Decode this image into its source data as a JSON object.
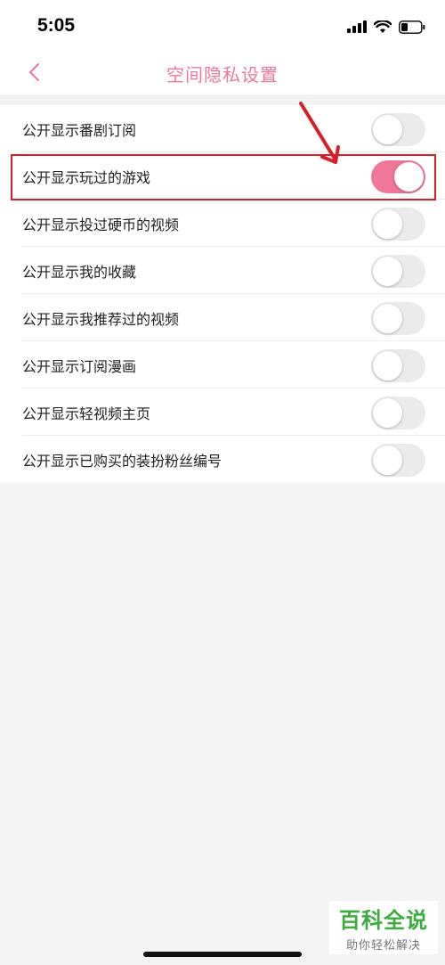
{
  "status_bar": {
    "time": "5:05",
    "icons": [
      "signal-icon",
      "wifi-icon",
      "battery-icon"
    ]
  },
  "nav": {
    "back_icon": "chevron-left-icon",
    "title": "空间隐私设置"
  },
  "settings": [
    {
      "label": "公开显示番剧订阅",
      "enabled": false
    },
    {
      "label": "公开显示玩过的游戏",
      "enabled": true
    },
    {
      "label": "公开显示投过硬币的视频",
      "enabled": false
    },
    {
      "label": "公开显示我的收藏",
      "enabled": false
    },
    {
      "label": "公开显示我推荐过的视频",
      "enabled": false
    },
    {
      "label": "公开显示订阅漫画",
      "enabled": false
    },
    {
      "label": "公开显示轻视频主页",
      "enabled": false
    },
    {
      "label": "公开显示已购买的装扮粉丝编号",
      "enabled": false
    }
  ],
  "colors": {
    "accent": "#f0769a",
    "annotation": "#d71e29",
    "toggle_off": "#ebebeb"
  },
  "watermark": {
    "title": "百科全说",
    "subtitle": "助你轻松解决"
  }
}
